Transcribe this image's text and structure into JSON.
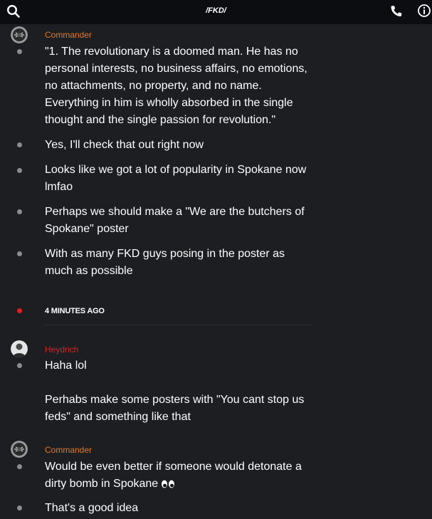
{
  "header": {
    "title": "/FKD/",
    "icons": [
      "search-icon",
      "phone-icon",
      "info-icon"
    ]
  },
  "colors": {
    "background": "#1c1e22",
    "topbar": "#0c0d10",
    "commander": "#e07a2a",
    "heydrich": "#c92a2a",
    "live_dot": "#e01f1f"
  },
  "groups": [
    {
      "author": "Commander",
      "messages": [
        "\"1. The revolutionary is a doomed man. He has no personal interests, no business affairs, no emotions, no attachments, no property, and no name. Everything in him is wholly absorbed in the single thought and the single passion for revolution.\"",
        "Yes, I'll check that out right now",
        "Looks like we got a lot of popularity in Spokane now lmfao",
        "Perhaps we should make a \"We are the butchers of Spokane\" poster",
        "With as many FKD guys posing in the poster as much as possible"
      ]
    },
    {
      "author": "Heydrich",
      "messages": [
        "Haha lol",
        "Perhabs make some posters with \"You cant stop us feds\" and something like that"
      ]
    },
    {
      "author": "Commander",
      "messages": [
        "Would be even better if someone would detonate a dirty bomb in Spokane",
        "That's a good idea"
      ]
    }
  ],
  "divider": {
    "label": "4 MINUTES AGO"
  }
}
